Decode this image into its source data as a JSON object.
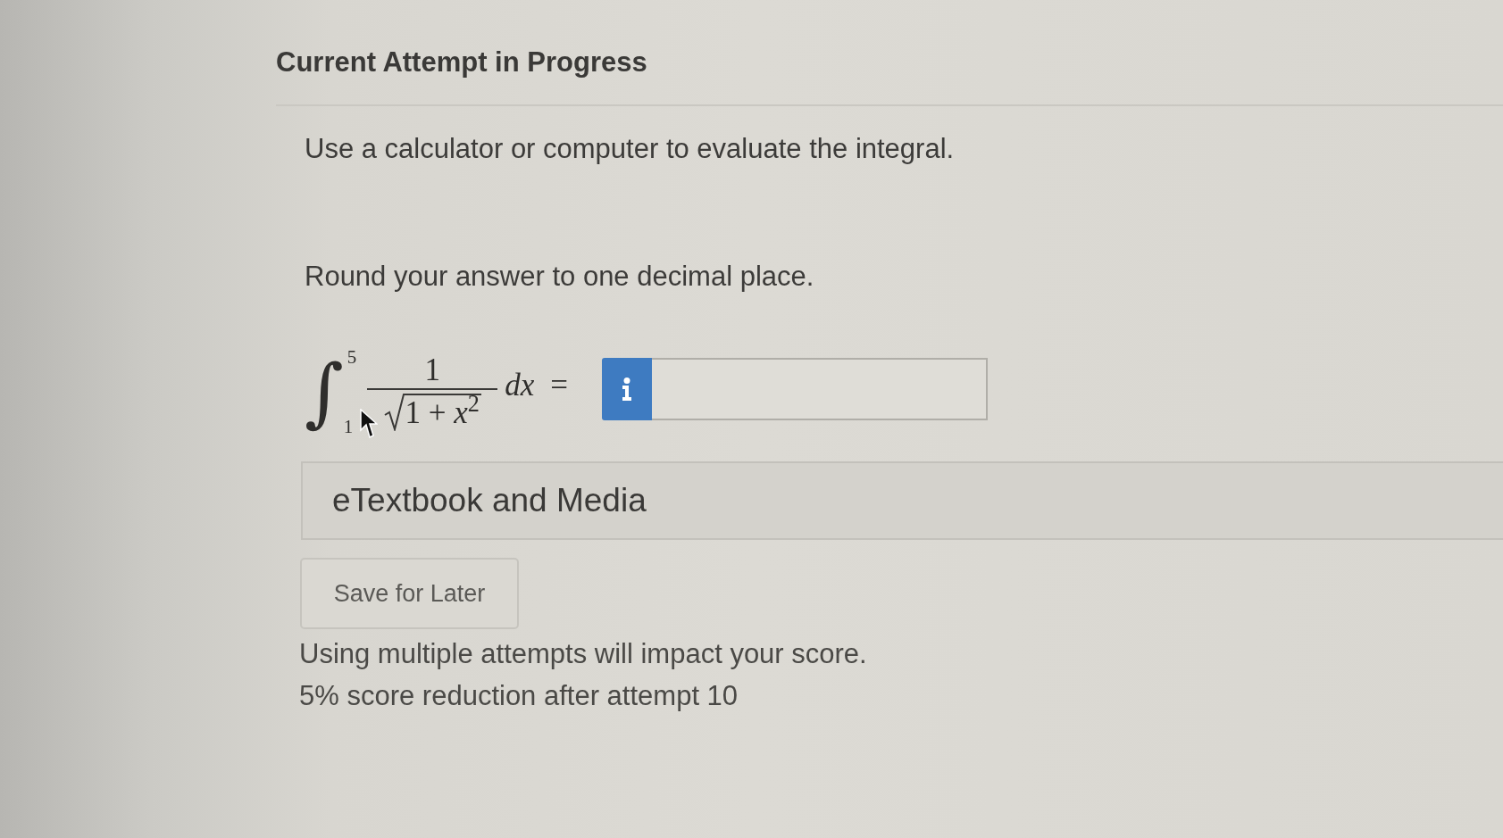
{
  "header": {
    "title": "Current Attempt in Progress"
  },
  "question": {
    "instructions": [
      "Use a calculator or computer to evaluate the integral.",
      "Round your answer to one decimal place."
    ],
    "integral": {
      "sign": "∫",
      "lower_limit": "1",
      "upper_limit": "5",
      "numerator": "1",
      "radicand": "1 + *x*$^{2}$",
      "differential": "dx",
      "equals": "="
    }
  },
  "resources": {
    "title": "eTextbook and Media"
  },
  "save_button": {
    "label": "Save for Later"
  },
  "notes": [
    "Using multiple attempts will impact your score.",
    "5% score reduction after attempt 10"
  ]
}
